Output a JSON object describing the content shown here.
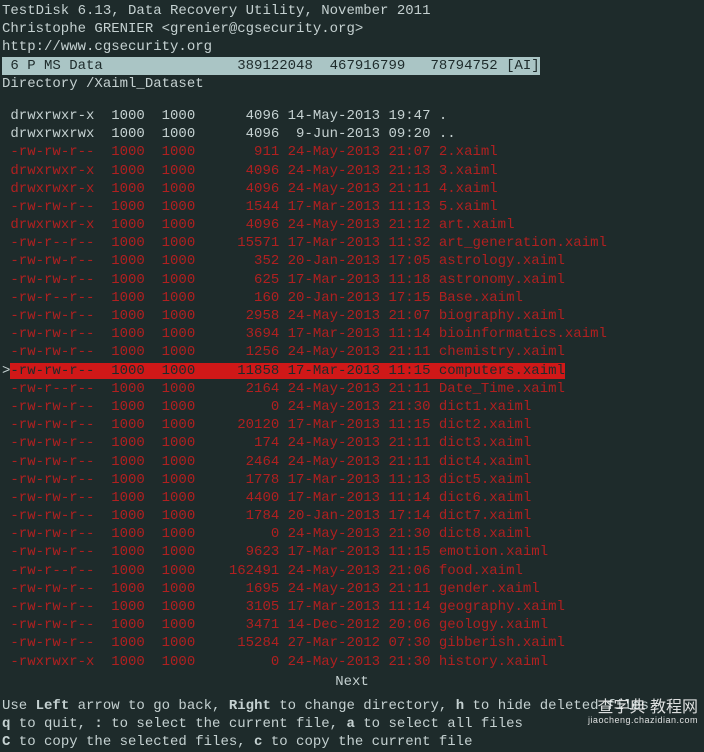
{
  "header": {
    "line1": "TestDisk 6.13, Data Recovery Utility, November 2011",
    "line2": "Christophe GRENIER <grenier@cgsecurity.org>",
    "line3": "http://www.cgsecurity.org"
  },
  "partition": " 6 P MS Data                389122048  467916799   78794752 [AI]",
  "directory": "Directory /Xaiml_Dataset",
  "rows": [
    {
      "cls": "normal",
      "perm": "drwxrwxr-x",
      "uid": "1000",
      "gid": "1000",
      "size": "4096",
      "date": "14-May-2013",
      "time": "19:47",
      "name": "."
    },
    {
      "cls": "normal",
      "perm": "drwxrwxrwx",
      "uid": "1000",
      "gid": "1000",
      "size": "4096",
      "date": " 9-Jun-2013",
      "time": "09:20",
      "name": ".."
    },
    {
      "cls": "deleted",
      "perm": "-rw-rw-r--",
      "uid": "1000",
      "gid": "1000",
      "size": "911",
      "date": "24-May-2013",
      "time": "21:07",
      "name": "2.xaiml"
    },
    {
      "cls": "deleted",
      "perm": "drwxrwxr-x",
      "uid": "1000",
      "gid": "1000",
      "size": "4096",
      "date": "24-May-2013",
      "time": "21:13",
      "name": "3.xaiml"
    },
    {
      "cls": "deleted",
      "perm": "drwxrwxr-x",
      "uid": "1000",
      "gid": "1000",
      "size": "4096",
      "date": "24-May-2013",
      "time": "21:11",
      "name": "4.xaiml"
    },
    {
      "cls": "deleted",
      "perm": "-rw-rw-r--",
      "uid": "1000",
      "gid": "1000",
      "size": "1544",
      "date": "17-Mar-2013",
      "time": "11:13",
      "name": "5.xaiml"
    },
    {
      "cls": "deleted",
      "perm": "drwxrwxr-x",
      "uid": "1000",
      "gid": "1000",
      "size": "4096",
      "date": "24-May-2013",
      "time": "21:12",
      "name": "art.xaiml"
    },
    {
      "cls": "deleted",
      "perm": "-rw-r--r--",
      "uid": "1000",
      "gid": "1000",
      "size": "15571",
      "date": "17-Mar-2013",
      "time": "11:32",
      "name": "art_generation.xaiml"
    },
    {
      "cls": "deleted",
      "perm": "-rw-rw-r--",
      "uid": "1000",
      "gid": "1000",
      "size": "352",
      "date": "20-Jan-2013",
      "time": "17:05",
      "name": "astrology.xaiml"
    },
    {
      "cls": "deleted",
      "perm": "-rw-rw-r--",
      "uid": "1000",
      "gid": "1000",
      "size": "625",
      "date": "17-Mar-2013",
      "time": "11:18",
      "name": "astronomy.xaiml"
    },
    {
      "cls": "deleted",
      "perm": "-rw-r--r--",
      "uid": "1000",
      "gid": "1000",
      "size": "160",
      "date": "20-Jan-2013",
      "time": "17:15",
      "name": "Base.xaiml"
    },
    {
      "cls": "deleted",
      "perm": "-rw-rw-r--",
      "uid": "1000",
      "gid": "1000",
      "size": "2958",
      "date": "24-May-2013",
      "time": "21:07",
      "name": "biography.xaiml"
    },
    {
      "cls": "deleted",
      "perm": "-rw-rw-r--",
      "uid": "1000",
      "gid": "1000",
      "size": "3694",
      "date": "17-Mar-2013",
      "time": "11:14",
      "name": "bioinformatics.xaiml"
    },
    {
      "cls": "deleted",
      "perm": "-rw-rw-r--",
      "uid": "1000",
      "gid": "1000",
      "size": "1256",
      "date": "24-May-2013",
      "time": "21:11",
      "name": "chemistry.xaiml"
    },
    {
      "cls": "selected",
      "perm": "-rw-rw-r--",
      "uid": "1000",
      "gid": "1000",
      "size": "11858",
      "date": "17-Mar-2013",
      "time": "11:15",
      "name": "computers.xaiml",
      "cursor": ">"
    },
    {
      "cls": "deleted",
      "perm": "-rw-r--r--",
      "uid": "1000",
      "gid": "1000",
      "size": "2164",
      "date": "24-May-2013",
      "time": "21:11",
      "name": "Date_Time.xaiml"
    },
    {
      "cls": "deleted",
      "perm": "-rw-rw-r--",
      "uid": "1000",
      "gid": "1000",
      "size": "0",
      "date": "24-May-2013",
      "time": "21:30",
      "name": "dict1.xaiml"
    },
    {
      "cls": "deleted",
      "perm": "-rw-rw-r--",
      "uid": "1000",
      "gid": "1000",
      "size": "20120",
      "date": "17-Mar-2013",
      "time": "11:15",
      "name": "dict2.xaiml"
    },
    {
      "cls": "deleted",
      "perm": "-rw-rw-r--",
      "uid": "1000",
      "gid": "1000",
      "size": "174",
      "date": "24-May-2013",
      "time": "21:11",
      "name": "dict3.xaiml"
    },
    {
      "cls": "deleted",
      "perm": "-rw-rw-r--",
      "uid": "1000",
      "gid": "1000",
      "size": "2464",
      "date": "24-May-2013",
      "time": "21:11",
      "name": "dict4.xaiml"
    },
    {
      "cls": "deleted",
      "perm": "-rw-rw-r--",
      "uid": "1000",
      "gid": "1000",
      "size": "1778",
      "date": "17-Mar-2013",
      "time": "11:13",
      "name": "dict5.xaiml"
    },
    {
      "cls": "deleted",
      "perm": "-rw-rw-r--",
      "uid": "1000",
      "gid": "1000",
      "size": "4400",
      "date": "17-Mar-2013",
      "time": "11:14",
      "name": "dict6.xaiml"
    },
    {
      "cls": "deleted",
      "perm": "-rw-rw-r--",
      "uid": "1000",
      "gid": "1000",
      "size": "1784",
      "date": "20-Jan-2013",
      "time": "17:14",
      "name": "dict7.xaiml"
    },
    {
      "cls": "deleted",
      "perm": "-rw-rw-r--",
      "uid": "1000",
      "gid": "1000",
      "size": "0",
      "date": "24-May-2013",
      "time": "21:30",
      "name": "dict8.xaiml"
    },
    {
      "cls": "deleted",
      "perm": "-rw-rw-r--",
      "uid": "1000",
      "gid": "1000",
      "size": "9623",
      "date": "17-Mar-2013",
      "time": "11:15",
      "name": "emotion.xaiml"
    },
    {
      "cls": "deleted",
      "perm": "-rw-r--r--",
      "uid": "1000",
      "gid": "1000",
      "size": "162491",
      "date": "24-May-2013",
      "time": "21:06",
      "name": "food.xaiml"
    },
    {
      "cls": "deleted",
      "perm": "-rw-rw-r--",
      "uid": "1000",
      "gid": "1000",
      "size": "1695",
      "date": "24-May-2013",
      "time": "21:11",
      "name": "gender.xaiml"
    },
    {
      "cls": "deleted",
      "perm": "-rw-rw-r--",
      "uid": "1000",
      "gid": "1000",
      "size": "3105",
      "date": "17-Mar-2013",
      "time": "11:14",
      "name": "geography.xaiml"
    },
    {
      "cls": "deleted",
      "perm": "-rw-rw-r--",
      "uid": "1000",
      "gid": "1000",
      "size": "3471",
      "date": "14-Dec-2012",
      "time": "20:06",
      "name": "geology.xaiml"
    },
    {
      "cls": "deleted",
      "perm": "-rw-rw-r--",
      "uid": "1000",
      "gid": "1000",
      "size": "15284",
      "date": "27-Mar-2012",
      "time": "07:30",
      "name": "gibberish.xaiml"
    },
    {
      "cls": "deleted",
      "perm": "-rwxrwxr-x",
      "uid": "1000",
      "gid": "1000",
      "size": "0",
      "date": "24-May-2013",
      "time": "21:30",
      "name": "history.xaiml"
    }
  ],
  "next_label": "Next",
  "footer": {
    "parts": [
      {
        "t": "Use "
      },
      {
        "b": "Left"
      },
      {
        "t": " arrow to go back, "
      },
      {
        "b": "Right"
      },
      {
        "t": " to change directory, "
      },
      {
        "b": "h"
      },
      {
        "t": " to hide deleted files"
      },
      {
        "br": true
      },
      {
        "t": "    "
      },
      {
        "b": "q"
      },
      {
        "t": " to quit, "
      },
      {
        "b": ":"
      },
      {
        "t": " to select the current file, "
      },
      {
        "b": "a"
      },
      {
        "t": " to select all files"
      },
      {
        "br": true
      },
      {
        "t": "    "
      },
      {
        "b": "C"
      },
      {
        "t": " to copy the selected files, "
      },
      {
        "b": "c"
      },
      {
        "t": " to copy the current file"
      }
    ]
  },
  "watermark": {
    "main": "查字典 教程网",
    "sub": "jiaocheng.chazidian.com"
  }
}
